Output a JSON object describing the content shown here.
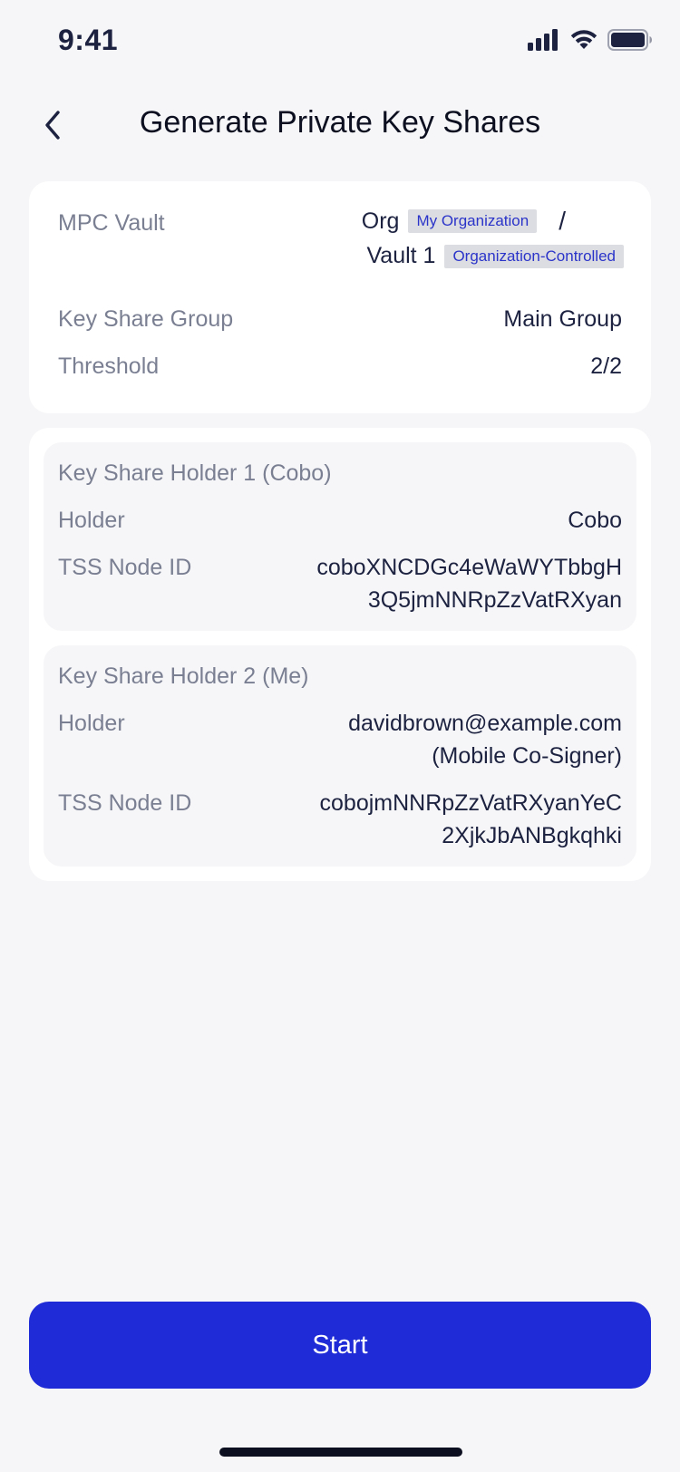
{
  "status_bar": {
    "time": "9:41",
    "icons": [
      "cellular-signal-icon",
      "wifi-icon",
      "battery-icon"
    ]
  },
  "header": {
    "back_icon": "chevron-left-icon",
    "title": "Generate Private Key Shares"
  },
  "vault_info": {
    "mpc_vault_label": "MPC Vault",
    "org_name": "Org",
    "org_tag": "My Organization",
    "separator": "/",
    "vault_name": "Vault 1",
    "vault_tag": "Organization-Controlled",
    "key_share_group_label": "Key Share Group",
    "key_share_group_value": "Main Group",
    "threshold_label": "Threshold",
    "threshold_value": "2/2"
  },
  "holders": [
    {
      "title": "Key Share Holder 1 (Cobo)",
      "holder_label": "Holder",
      "holder_value_line1": "Cobo",
      "holder_value_line2": "",
      "node_label": "TSS Node ID",
      "node_value_line1": "coboXNCDGc4eWaWYTbbgH",
      "node_value_line2": "3Q5jmNNRpZzVatRXyan"
    },
    {
      "title": "Key Share Holder 2 (Me)",
      "holder_label": "Holder",
      "holder_value_line1": "davidbrown@example.com",
      "holder_value_line2": "(Mobile Co-Signer)",
      "node_label": "TSS Node ID",
      "node_value_line1": "cobojmNNRpZzVatRXyanYeC",
      "node_value_line2": "2XjkJbANBgkqhki"
    }
  ],
  "actions": {
    "start_label": "Start"
  },
  "colors": {
    "background": "#f6f6f8",
    "card": "#ffffff",
    "primary": "#1f2bd6",
    "tag_bg": "#dcdde2",
    "tag_text": "#2b34c9",
    "label_text": "#7a7f92",
    "value_text": "#1c2240"
  }
}
